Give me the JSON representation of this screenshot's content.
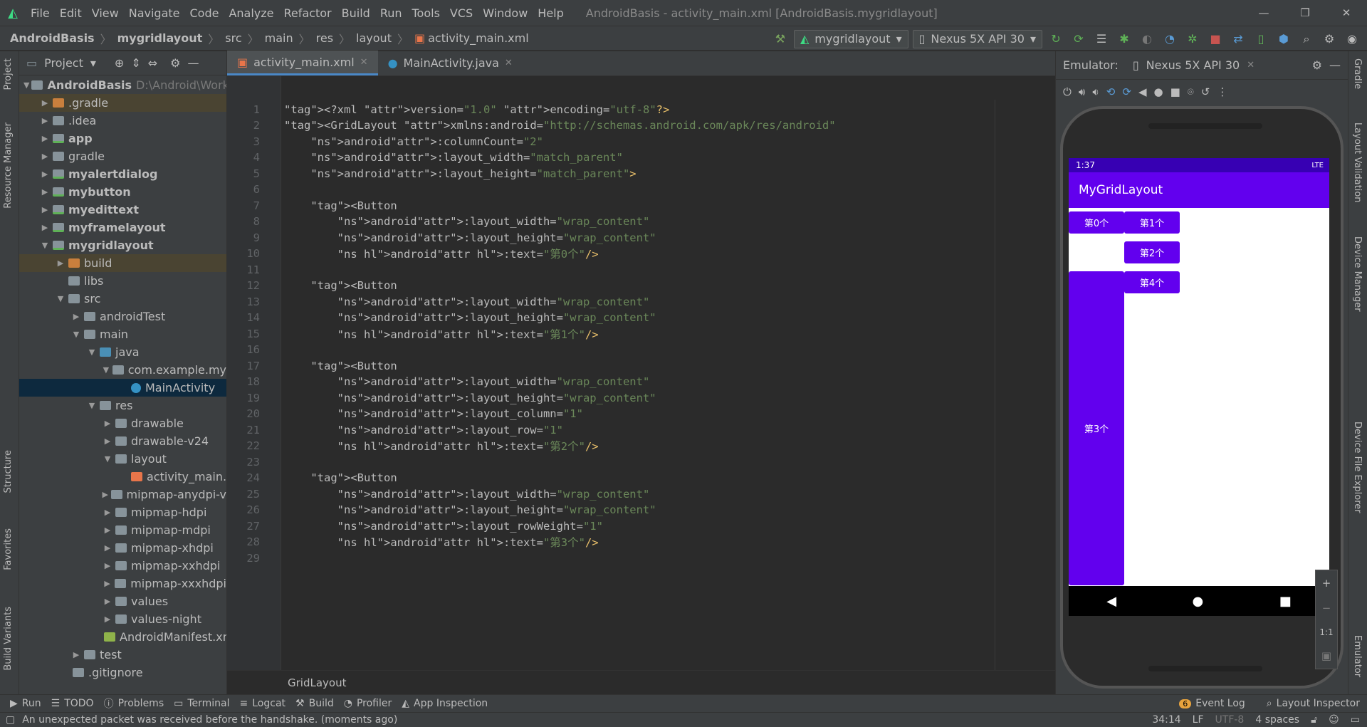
{
  "menubar": {
    "items": [
      "File",
      "Edit",
      "View",
      "Navigate",
      "Code",
      "Analyze",
      "Refactor",
      "Build",
      "Run",
      "Tools",
      "VCS",
      "Window",
      "Help"
    ],
    "title": "AndroidBasis - activity_main.xml [AndroidBasis.mygridlayout]"
  },
  "breadcrumb": [
    "AndroidBasis",
    "mygridlayout",
    "src",
    "main",
    "res",
    "layout",
    "activity_main.xml"
  ],
  "toolbar": {
    "run_config": "mygridlayout",
    "device": "Nexus 5X API 30"
  },
  "project": {
    "title": "Project",
    "rows": [
      {
        "label": "AndroidBasis",
        "extra": "D:\\Android\\Works",
        "bold": true
      },
      {
        "label": ".gradle"
      },
      {
        "label": ".idea"
      },
      {
        "label": "app",
        "bold": true
      },
      {
        "label": "gradle"
      },
      {
        "label": "myalertdialog",
        "bold": true
      },
      {
        "label": "mybutton",
        "bold": true
      },
      {
        "label": "myedittext",
        "bold": true
      },
      {
        "label": "myframelayout",
        "bold": true
      },
      {
        "label": "mygridlayout",
        "bold": true
      },
      {
        "label": "build"
      },
      {
        "label": "libs"
      },
      {
        "label": "src"
      },
      {
        "label": "androidTest"
      },
      {
        "label": "main"
      },
      {
        "label": "java"
      },
      {
        "label": "com.example.my"
      },
      {
        "label": "MainActivity"
      },
      {
        "label": "res"
      },
      {
        "label": "drawable"
      },
      {
        "label": "drawable-v24"
      },
      {
        "label": "layout"
      },
      {
        "label": "activity_main.x"
      },
      {
        "label": "mipmap-anydpi-v"
      },
      {
        "label": "mipmap-hdpi"
      },
      {
        "label": "mipmap-mdpi"
      },
      {
        "label": "mipmap-xhdpi"
      },
      {
        "label": "mipmap-xxhdpi"
      },
      {
        "label": "mipmap-xxxhdpi"
      },
      {
        "label": "values"
      },
      {
        "label": "values-night"
      },
      {
        "label": "AndroidManifest.xm"
      },
      {
        "label": "test"
      },
      {
        "label": ".gitignore"
      }
    ]
  },
  "left_strip": [
    "Project",
    "Resource Manager",
    "Structure",
    "Favorites",
    "Build Variants"
  ],
  "right_strip": [
    "Gradle",
    "Layout Validation",
    "Device Manager",
    "Device File Explorer",
    "Emulator"
  ],
  "tabs": [
    "activity_main.xml",
    "MainActivity.java"
  ],
  "code_lines": [
    "<?xml version=\"1.0\" encoding=\"utf-8\"?>",
    "<GridLayout xmlns:android=\"http://schemas.android.com/apk/res/android\"",
    "    android:columnCount=\"2\"",
    "    android:layout_width=\"match_parent\"",
    "    android:layout_height=\"match_parent\">",
    "",
    "    <Button",
    "        android:layout_width=\"wrap_content\"",
    "        android:layout_height=\"wrap_content\"",
    "        android:text=\"第0个\"/>",
    "",
    "    <Button",
    "        android:layout_width=\"wrap_content\"",
    "        android:layout_height=\"wrap_content\"",
    "        android:text=\"第1个\"/>",
    "",
    "    <Button",
    "        android:layout_width=\"wrap_content\"",
    "        android:layout_height=\"wrap_content\"",
    "        android:layout_column=\"1\"",
    "        android:layout_row=\"1\"",
    "        android:text=\"第2个\"/>",
    "",
    "    <Button",
    "        android:layout_width=\"wrap_content\"",
    "        android:layout_height=\"wrap_content\"",
    "        android:layout_rowWeight=\"1\"",
    "        android:text=\"第3个\"/>",
    ""
  ],
  "editor_footer": "GridLayout",
  "emulator": {
    "label": "Emulator:",
    "device_tab": "Nexus 5X API 30",
    "status_time": "1:37",
    "status_right": "LTE",
    "app_title": "MyGridLayout",
    "buttons": [
      "第0个",
      "第1个",
      "第2个",
      "第3个",
      "第4个"
    ],
    "zoom_ratio": "1:1"
  },
  "bottom_tools": [
    "Run",
    "TODO",
    "Problems",
    "Terminal",
    "Logcat",
    "Build",
    "Profiler",
    "App Inspection"
  ],
  "bottom_right": {
    "event_log": "Event Log",
    "event_count": "6",
    "layout_inspector": "Layout Inspector"
  },
  "status": {
    "message": "An unexpected packet was received before the handshake. (moments ago)",
    "position": "34:14",
    "line_sep": "LF",
    "encoding": "UTF-8",
    "indent": "4 spaces"
  }
}
